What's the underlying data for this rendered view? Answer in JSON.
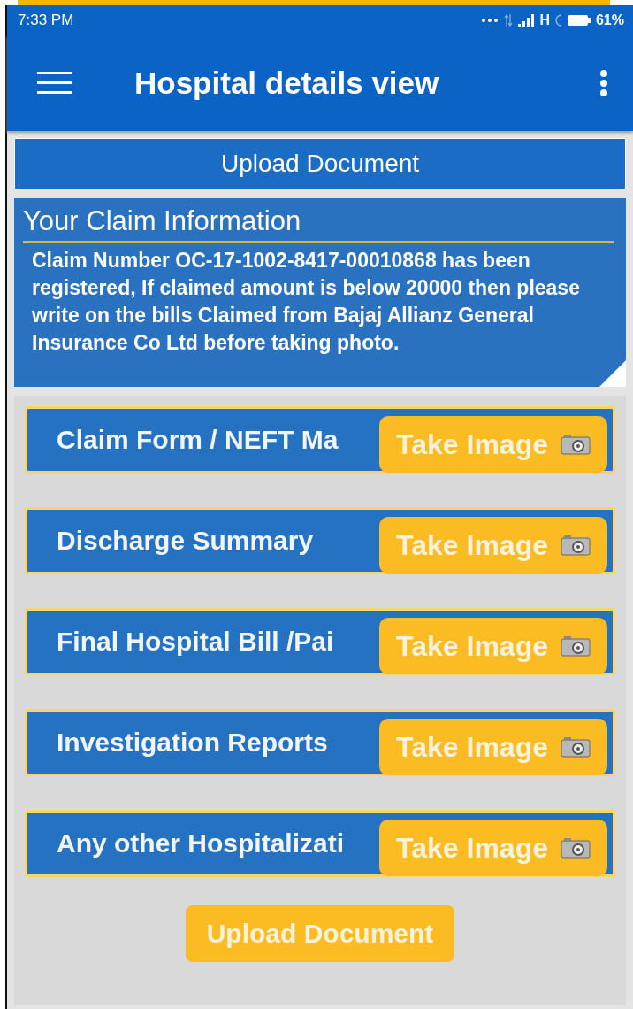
{
  "status_bar": {
    "time": "7:33 PM",
    "network": "H",
    "battery": "61%"
  },
  "app_bar": {
    "title": "Hospital details view"
  },
  "upload_bar": {
    "label": "Upload Document"
  },
  "claim_info": {
    "title": "Your Claim Information",
    "message": "Claim Number OC-17-1002-8417-00010868 has been registered, If claimed amount is below 20000 then please write on the bills Claimed from Bajaj Allianz General Insurance Co Ltd before taking photo."
  },
  "documents": [
    {
      "label": "Claim Form / NEFT Ma",
      "button": "Take Image"
    },
    {
      "label": "Discharge Summary",
      "button": "Take Image"
    },
    {
      "label": "Final Hospital Bill /Pai",
      "button": "Take Image"
    },
    {
      "label": "Investigation Reports",
      "button": "Take Image"
    },
    {
      "label": "Any other Hospitalizati",
      "button": "Take Image"
    }
  ],
  "upload_button": {
    "label": "Upload Document"
  }
}
